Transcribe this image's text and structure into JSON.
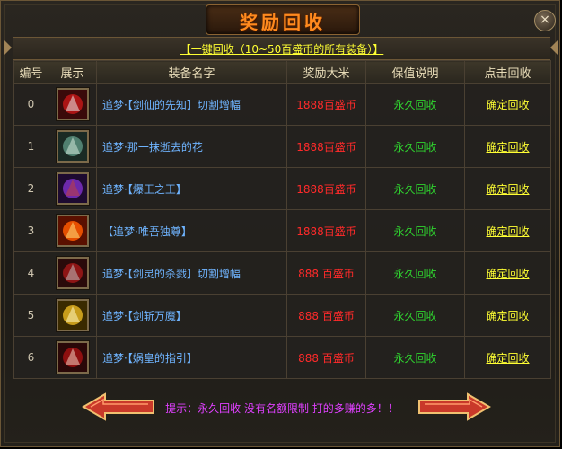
{
  "window": {
    "title": "奖励回收",
    "close_label": "×"
  },
  "recycle_all": {
    "label": "【一键回收（10~50百盛币的所有装备）】"
  },
  "table": {
    "headers": [
      "编号",
      "展示",
      "装备名字",
      "奖励大米",
      "保值说明",
      "点击回收"
    ],
    "rows": [
      {
        "index": "0",
        "icon": "bloody-blade-icon",
        "name": "追梦·【剑仙的先知】切割增幅",
        "reward": "1888百盛币",
        "note": "永久回收",
        "action": "确定回收",
        "colors": [
          "#3a0a0a",
          "#c01616",
          "#e8e8e8"
        ]
      },
      {
        "index": "1",
        "icon": "ghost-warrior-icon",
        "name": "追梦·那一抹逝去的花",
        "reward": "1888百盛币",
        "note": "永久回收",
        "action": "确定回收",
        "colors": [
          "#1a2a24",
          "#5b8f7e",
          "#cfe6d8"
        ]
      },
      {
        "index": "2",
        "icon": "hooded-mage-icon",
        "name": "追梦·【爆王之王】",
        "reward": "1888百盛币",
        "note": "永久回收",
        "action": "确定回收",
        "colors": [
          "#1d0a30",
          "#7b2fc2",
          "#c04040"
        ]
      },
      {
        "index": "3",
        "icon": "fire-pillar-icon",
        "name": "【追梦·唯吾独尊】",
        "reward": "1888百盛币",
        "note": "永久回收",
        "action": "确定回收",
        "colors": [
          "#5a1000",
          "#ff5a00",
          "#ffe07a"
        ]
      },
      {
        "index": "4",
        "icon": "axe-warrior-icon",
        "name": "追梦·【剑灵的杀戮】切割增幅",
        "reward": "888 百盛币",
        "note": "永久回收",
        "action": "确定回收",
        "colors": [
          "#2a0a0a",
          "#a01818",
          "#bdbdbd"
        ]
      },
      {
        "index": "5",
        "icon": "crossed-swords-icon",
        "name": "追梦·【剑斩万魔】",
        "reward": "888 百盛币",
        "note": "永久回收",
        "action": "确定回收",
        "colors": [
          "#3a2a00",
          "#e0b020",
          "#fff7c0"
        ]
      },
      {
        "index": "6",
        "icon": "blood-fist-icon",
        "name": "追梦·【娲皇的指引】",
        "reward": "888 百盛币",
        "note": "永久回收",
        "action": "确定回收",
        "colors": [
          "#2a0808",
          "#a01010",
          "#f0d0c0"
        ]
      }
    ]
  },
  "footer": {
    "hint": "提示：永久回收 没有名额限制 打的多赚的多！！",
    "prev_icon": "prev-arrow-icon",
    "next_icon": "next-arrow-icon",
    "arrow_color": "#d8452a"
  }
}
